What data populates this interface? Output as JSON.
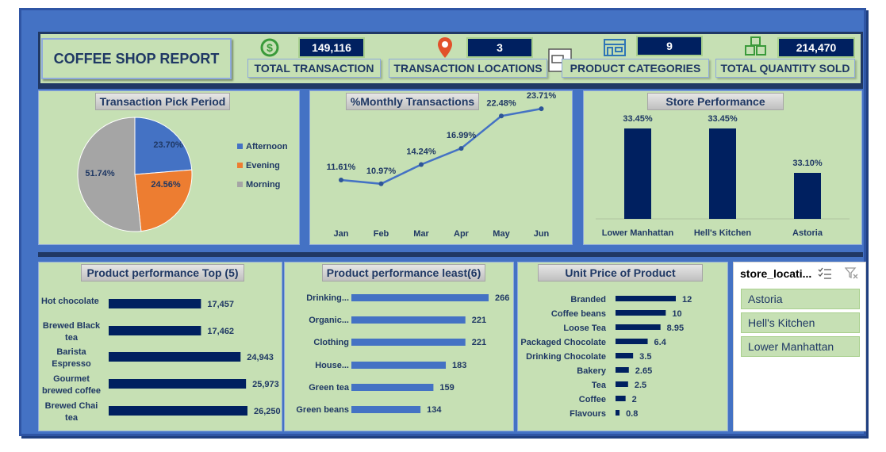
{
  "header": {
    "title": "COFFEE SHOP REPORT",
    "kpis": [
      {
        "value": "149,116",
        "label": "TOTAL TRANSACTION",
        "icon": "dollar-icon"
      },
      {
        "value": "3",
        "label": "TRANSACTION LOCATIONS",
        "icon": "location-pin-icon"
      },
      {
        "value": "9",
        "label": "PRODUCT CATEGORIES",
        "icon": "store-icon"
      },
      {
        "value": "214,470",
        "label": "TOTAL QUANTITY SOLD",
        "icon": "boxes-icon"
      }
    ]
  },
  "chart_data": [
    {
      "type": "pie",
      "title": "Transaction Pick Period",
      "categories": [
        "Afternoon",
        "Evening",
        "Morning"
      ],
      "values": [
        23.7,
        24.56,
        51.74
      ],
      "labels": [
        "23.70%",
        "24.56%",
        "51.74%"
      ],
      "colors": [
        "#4472c4",
        "#ed7d31",
        "#a5a5a5"
      ],
      "legend": "right"
    },
    {
      "type": "line",
      "title": "%Monthly Transactions",
      "categories": [
        "Jan",
        "Feb",
        "Mar",
        "Apr",
        "May",
        "Jun"
      ],
      "values": [
        11.61,
        10.97,
        14.24,
        16.99,
        22.48,
        23.71
      ],
      "labels": [
        "11.61%",
        "10.97%",
        "14.24%",
        "16.99%",
        "22.48%",
        "23.71%"
      ],
      "color": "#4472c4"
    },
    {
      "type": "bar",
      "title": "Store Performance",
      "categories": [
        "Lower Manhattan",
        "Hell's Kitchen",
        "Astoria"
      ],
      "values": [
        33.45,
        33.45,
        33.1
      ],
      "labels": [
        "33.45%",
        "33.45%",
        "33.10%"
      ],
      "color": "#002060"
    },
    {
      "type": "bar",
      "orientation": "horizontal",
      "title": "Product performance Top (5)",
      "categories": [
        "Hot chocolate",
        "Brewed Black tea",
        "Barista Espresso",
        "Gourmet brewed coffee",
        "Brewed Chai tea"
      ],
      "values": [
        17457,
        17462,
        24943,
        25973,
        26250
      ],
      "labels": [
        "17,457",
        "17,462",
        "24,943",
        "25,973",
        "26,250"
      ],
      "color": "#002060"
    },
    {
      "type": "bar",
      "orientation": "horizontal",
      "title": "Product performance least(6)",
      "categories": [
        "Drinking...",
        "Organic...",
        "Clothing",
        "House...",
        "Green tea",
        "Green beans"
      ],
      "values": [
        266,
        221,
        221,
        183,
        159,
        134
      ],
      "labels": [
        "266",
        "221",
        "221",
        "183",
        "159",
        "134"
      ],
      "color": "#4472c4"
    },
    {
      "type": "bar",
      "orientation": "horizontal",
      "title": "Unit Price of Product",
      "categories": [
        "Branded",
        "Coffee beans",
        "Loose Tea",
        "Packaged Chocolate",
        "Drinking Chocolate",
        "Bakery",
        "Tea",
        "Coffee",
        "Flavours"
      ],
      "values": [
        12,
        10,
        8.95,
        6.4,
        3.5,
        2.65,
        2.5,
        2,
        0.8
      ],
      "labels": [
        "12",
        "10",
        "8.95",
        "6.4",
        "3.5",
        "2.65",
        "2.5",
        "2",
        "0.8"
      ],
      "color": "#002060"
    }
  ],
  "slicer": {
    "title": "store_locati...",
    "items": [
      "Astoria",
      "Hell's Kitchen",
      "Lower Manhattan"
    ]
  }
}
